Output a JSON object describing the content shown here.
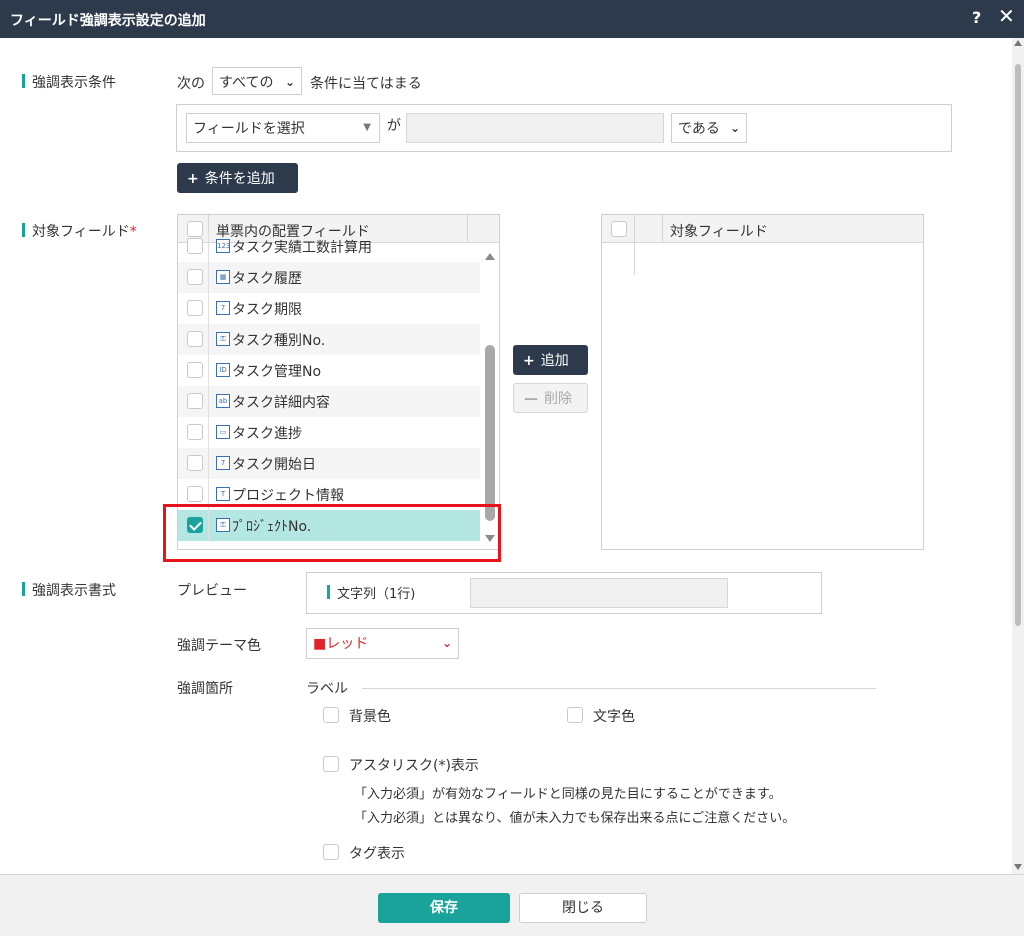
{
  "dialog": {
    "title": "フィールド強調表示設定の追加",
    "help_label": "?",
    "close_label": "✕"
  },
  "condition": {
    "section_label": "強調表示条件",
    "prefix": "次の",
    "match_select": "すべての",
    "suffix": "条件に当てはまる",
    "field_select": "フィールドを選択",
    "ga_label": "が",
    "value_input": "",
    "operator_select": "である",
    "add_button": "条件を追加"
  },
  "target": {
    "section_label": "対象フィールド",
    "required_mark": "*",
    "left_header": "単票内の配置フィールド",
    "left_items": [
      {
        "label": "タスク実績工数計算用",
        "icon": "calc-icon",
        "icon_text": "123",
        "checked": false
      },
      {
        "label": "タスク履歴",
        "icon": "table-icon",
        "icon_text": "▦",
        "checked": false
      },
      {
        "label": "タスク期限",
        "icon": "calendar-icon",
        "icon_text": "7",
        "checked": false
      },
      {
        "label": "タスク種別No.",
        "icon": "lookup-key-icon",
        "icon_text": "⚿",
        "checked": false
      },
      {
        "label": "タスク管理No",
        "icon": "id-icon",
        "icon_text": "ID",
        "checked": false
      },
      {
        "label": "タスク詳細内容",
        "icon": "multiline-text-icon",
        "icon_text": "ab",
        "checked": false
      },
      {
        "label": "タスク進捗",
        "icon": "progress-icon",
        "icon_text": "▭",
        "checked": false
      },
      {
        "label": "タスク開始日",
        "icon": "calendar-icon",
        "icon_text": "7",
        "checked": false
      },
      {
        "label": "プロジェクト情報",
        "icon": "text-icon",
        "icon_text": "T",
        "checked": false
      },
      {
        "label": "ﾌﾟﾛｼﾞｪｸﾄNo.",
        "icon": "lookup-key-icon",
        "icon_text": "⚿",
        "checked": true
      }
    ],
    "add_button": "追加",
    "remove_button": "削除",
    "right_header": "対象フィールド"
  },
  "format": {
    "section_label": "強調表示書式",
    "preview_label": "プレビュー",
    "preview_field_label": "文字列（1行)",
    "theme_label": "強調テーマ色",
    "theme_value": "■レッド",
    "theme_color": "#e0242a",
    "target_label": "強調箇所",
    "label_group": "ラベル",
    "bg_color": "背景色",
    "text_color": "文字色",
    "asterisk_label": "アスタリスク(*)表示",
    "asterisk_note1": "「入力必須」が有効なフィールドと同様の見た目にすることができます。",
    "asterisk_note2": "「入力必須」とは異なり、値が未入力でも保存出来る点にご注意ください。",
    "tag_label": "タグ表示"
  },
  "footer": {
    "save": "保存",
    "close": "閉じる"
  }
}
